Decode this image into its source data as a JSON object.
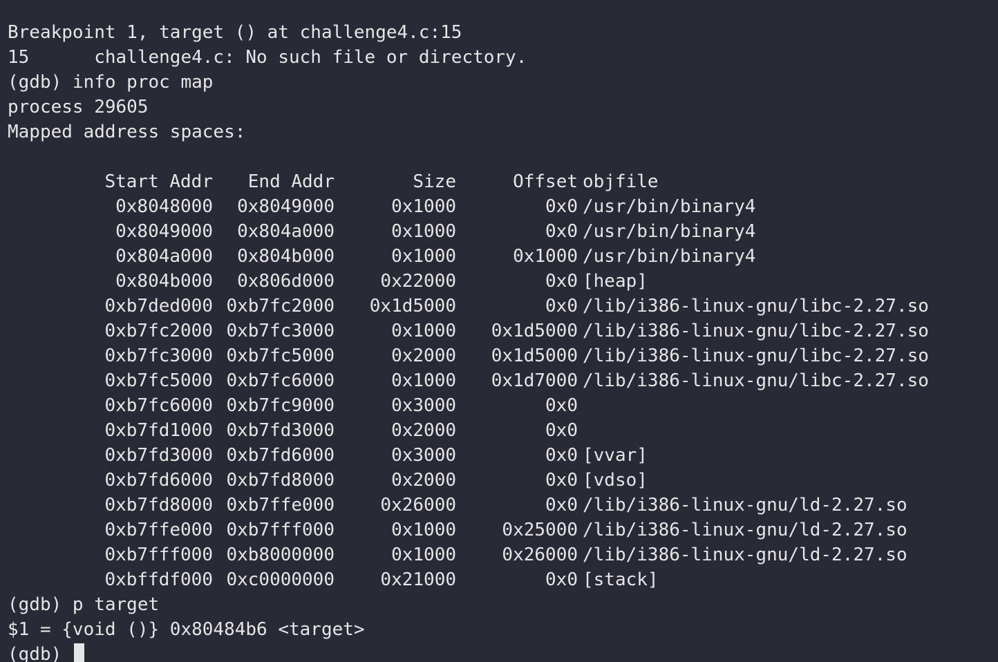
{
  "terminal": {
    "intro_lines": [
      "Breakpoint 1, target () at challenge4.c:15",
      "15      challenge4.c: No such file or directory.",
      "(gdb) info proc map",
      "process 29605",
      "Mapped address spaces:"
    ],
    "map_header": {
      "start": "Start Addr",
      "end": "End Addr",
      "size": "Size",
      "offset": "Offset",
      "objfile": "objfile"
    },
    "map_rows": [
      {
        "start": "0x8048000",
        "end": "0x8049000",
        "size": "0x1000",
        "offset": "0x0",
        "objfile": "/usr/bin/binary4"
      },
      {
        "start": "0x8049000",
        "end": "0x804a000",
        "size": "0x1000",
        "offset": "0x0",
        "objfile": "/usr/bin/binary4"
      },
      {
        "start": "0x804a000",
        "end": "0x804b000",
        "size": "0x1000",
        "offset": "0x1000",
        "objfile": "/usr/bin/binary4"
      },
      {
        "start": "0x804b000",
        "end": "0x806d000",
        "size": "0x22000",
        "offset": "0x0",
        "objfile": "[heap]"
      },
      {
        "start": "0xb7ded000",
        "end": "0xb7fc2000",
        "size": "0x1d5000",
        "offset": "0x0",
        "objfile": "/lib/i386-linux-gnu/libc-2.27.so"
      },
      {
        "start": "0xb7fc2000",
        "end": "0xb7fc3000",
        "size": "0x1000",
        "offset": "0x1d5000",
        "objfile": "/lib/i386-linux-gnu/libc-2.27.so"
      },
      {
        "start": "0xb7fc3000",
        "end": "0xb7fc5000",
        "size": "0x2000",
        "offset": "0x1d5000",
        "objfile": "/lib/i386-linux-gnu/libc-2.27.so"
      },
      {
        "start": "0xb7fc5000",
        "end": "0xb7fc6000",
        "size": "0x1000",
        "offset": "0x1d7000",
        "objfile": "/lib/i386-linux-gnu/libc-2.27.so"
      },
      {
        "start": "0xb7fc6000",
        "end": "0xb7fc9000",
        "size": "0x3000",
        "offset": "0x0",
        "objfile": ""
      },
      {
        "start": "0xb7fd1000",
        "end": "0xb7fd3000",
        "size": "0x2000",
        "offset": "0x0",
        "objfile": ""
      },
      {
        "start": "0xb7fd3000",
        "end": "0xb7fd6000",
        "size": "0x3000",
        "offset": "0x0",
        "objfile": "[vvar]"
      },
      {
        "start": "0xb7fd6000",
        "end": "0xb7fd8000",
        "size": "0x2000",
        "offset": "0x0",
        "objfile": "[vdso]"
      },
      {
        "start": "0xb7fd8000",
        "end": "0xb7ffe000",
        "size": "0x26000",
        "offset": "0x0",
        "objfile": "/lib/i386-linux-gnu/ld-2.27.so"
      },
      {
        "start": "0xb7ffe000",
        "end": "0xb7fff000",
        "size": "0x1000",
        "offset": "0x25000",
        "objfile": "/lib/i386-linux-gnu/ld-2.27.so"
      },
      {
        "start": "0xb7fff000",
        "end": "0xb8000000",
        "size": "0x1000",
        "offset": "0x26000",
        "objfile": "/lib/i386-linux-gnu/ld-2.27.so"
      },
      {
        "start": "0xbffdf000",
        "end": "0xc0000000",
        "size": "0x21000",
        "offset": "0x0",
        "objfile": "[stack]"
      }
    ],
    "outro_lines": [
      "(gdb) p target",
      "$1 = {void ()} 0x80484b6 <target>"
    ],
    "prompt": "(gdb) "
  },
  "colors": {
    "background": "#282a36",
    "foreground": "#e6e6e6"
  }
}
